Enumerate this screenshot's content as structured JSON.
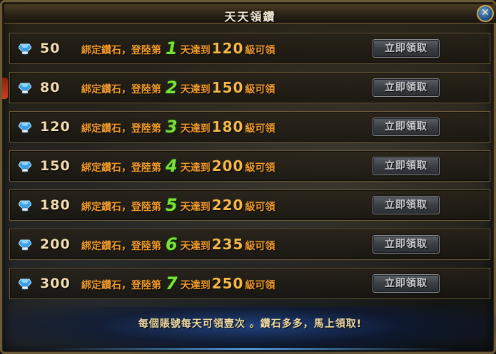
{
  "window": {
    "title": "天天領鑽",
    "close_icon": "close-x-icon"
  },
  "rows": [
    {
      "amount": "50",
      "text_a": "綁定鑽石，登陸第",
      "day": "1",
      "text_b": "天達到",
      "level": "120",
      "text_c": "級可領",
      "button": "立即領取"
    },
    {
      "amount": "80",
      "text_a": "綁定鑽石，登陸第",
      "day": "2",
      "text_b": "天達到",
      "level": "150",
      "text_c": "級可領",
      "button": "立即領取"
    },
    {
      "amount": "120",
      "text_a": "綁定鑽石，登陸第",
      "day": "3",
      "text_b": "天達到",
      "level": "180",
      "text_c": "級可領",
      "button": "立即領取"
    },
    {
      "amount": "150",
      "text_a": "綁定鑽石，登陸第",
      "day": "4",
      "text_b": "天達到",
      "level": "200",
      "text_c": "級可領",
      "button": "立即領取"
    },
    {
      "amount": "180",
      "text_a": "綁定鑽石，登陸第",
      "day": "5",
      "text_b": "天達到",
      "level": "220",
      "text_c": "級可領",
      "button": "立即領取"
    },
    {
      "amount": "200",
      "text_a": "綁定鑽石，登陸第",
      "day": "6",
      "text_b": "天達到",
      "level": "235",
      "text_c": "級可領",
      "button": "立即領取"
    },
    {
      "amount": "300",
      "text_a": "綁定鑽石，登陸第",
      "day": "7",
      "text_b": "天達到",
      "level": "250",
      "text_c": "級可領",
      "button": "立即領取"
    }
  ],
  "footer": {
    "text": "每個賬號每天可領壹次 。鑽石多多，馬上領取!"
  },
  "colors": {
    "frame": "#6b5a36",
    "amount": "#f4ddb0",
    "desc": "#f09b2c",
    "day_number": "#7be23a",
    "level_number": "#f7b84a",
    "button_text": "#c9cdd1"
  }
}
